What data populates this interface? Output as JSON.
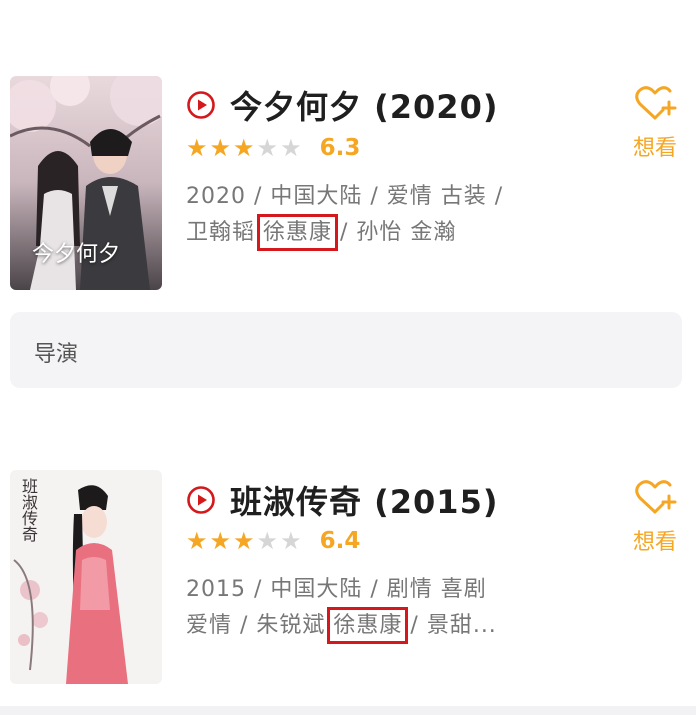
{
  "items": [
    {
      "title": "今夕何夕 (2020)",
      "rating": 6.3,
      "rating_text": "6.3",
      "stars_full": 3,
      "stars_total": 5,
      "meta_line1": "2020 / 中国大陆 / 爱情  古装 /",
      "meta_line2_before": "卫翰韬 ",
      "meta_line2_highlight": "徐惠康",
      "meta_line2_after": " / 孙怡  金瀚",
      "poster_text": "今夕何夕",
      "want_label": "想看"
    },
    {
      "title": "班淑传奇 (2015)",
      "rating": 6.4,
      "rating_text": "6.4",
      "stars_full": 3,
      "stars_total": 5,
      "meta_line1": "2015 / 中国大陆 / 剧情  喜剧",
      "meta_line2_before": "爱情 / 朱锐斌 ",
      "meta_line2_highlight": "徐惠康",
      "meta_line2_after": " / 景甜...",
      "poster_text": "班淑传奇",
      "want_label": "想看"
    }
  ],
  "role_section": {
    "label": "导演"
  },
  "colors": {
    "accent": "#f5a623",
    "highlight_box": "#d4181c",
    "play_icon": "#d4181c"
  },
  "icons": {
    "play": "play-circle-icon",
    "want": "heart-plus-icon",
    "star": "star-icon"
  }
}
